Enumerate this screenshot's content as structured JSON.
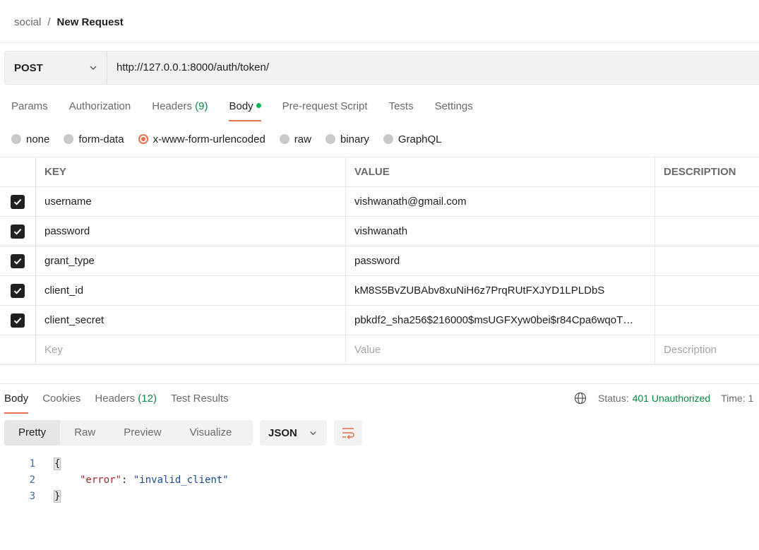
{
  "breadcrumb": {
    "parent": "social",
    "separator": "/",
    "current": "New Request"
  },
  "request": {
    "method": "POST",
    "url": "http://127.0.0.1:8000/auth/token/"
  },
  "request_tabs": [
    {
      "label": "Params",
      "count": ""
    },
    {
      "label": "Authorization",
      "count": ""
    },
    {
      "label": "Headers",
      "count": "(9)"
    },
    {
      "label": "Body",
      "count": ""
    },
    {
      "label": "Pre-request Script",
      "count": ""
    },
    {
      "label": "Tests",
      "count": ""
    },
    {
      "label": "Settings",
      "count": ""
    }
  ],
  "body_types": [
    "none",
    "form-data",
    "x-www-form-urlencoded",
    "raw",
    "binary",
    "GraphQL"
  ],
  "body_type_selected": "x-www-form-urlencoded",
  "table": {
    "headers": {
      "key": "KEY",
      "value": "VALUE",
      "description": "DESCRIPTION"
    },
    "rows": [
      {
        "key": "username",
        "value": "vishwanath@gmail.com",
        "description": ""
      },
      {
        "key": "password",
        "value": "vishwanath",
        "description": ""
      },
      {
        "key": "grant_type",
        "value": "password",
        "description": ""
      },
      {
        "key": "client_id",
        "value": "kM8S5BvZUBAbv8xuNiH6z7PrqRUtFXJYD1LPLDbS",
        "description": ""
      },
      {
        "key": "client_secret",
        "value": "pbkdf2_sha256$216000$msUGFXyw0bei$r84Cpa6wqoT…",
        "description": ""
      }
    ],
    "placeholders": {
      "key": "Key",
      "value": "Value",
      "description": "Description"
    }
  },
  "response_tabs": [
    {
      "label": "Body",
      "count": ""
    },
    {
      "label": "Cookies",
      "count": ""
    },
    {
      "label": "Headers",
      "count": "(12)"
    },
    {
      "label": "Test Results",
      "count": ""
    }
  ],
  "status": {
    "label": "Status:",
    "value": "401 Unauthorized",
    "time_label": "Time: 1"
  },
  "view_modes": [
    "Pretty",
    "Raw",
    "Preview",
    "Visualize"
  ],
  "format": "JSON",
  "code": {
    "line_numbers": [
      "1",
      "2",
      "3"
    ],
    "open_brace": "{",
    "key": "\"error\"",
    "colon": ": ",
    "value": "\"invalid_client\"",
    "close_brace": "}"
  },
  "colors": {
    "accent": "#e8704d",
    "status_ok": "#0b8a3e",
    "dot": "#0cbb52"
  }
}
